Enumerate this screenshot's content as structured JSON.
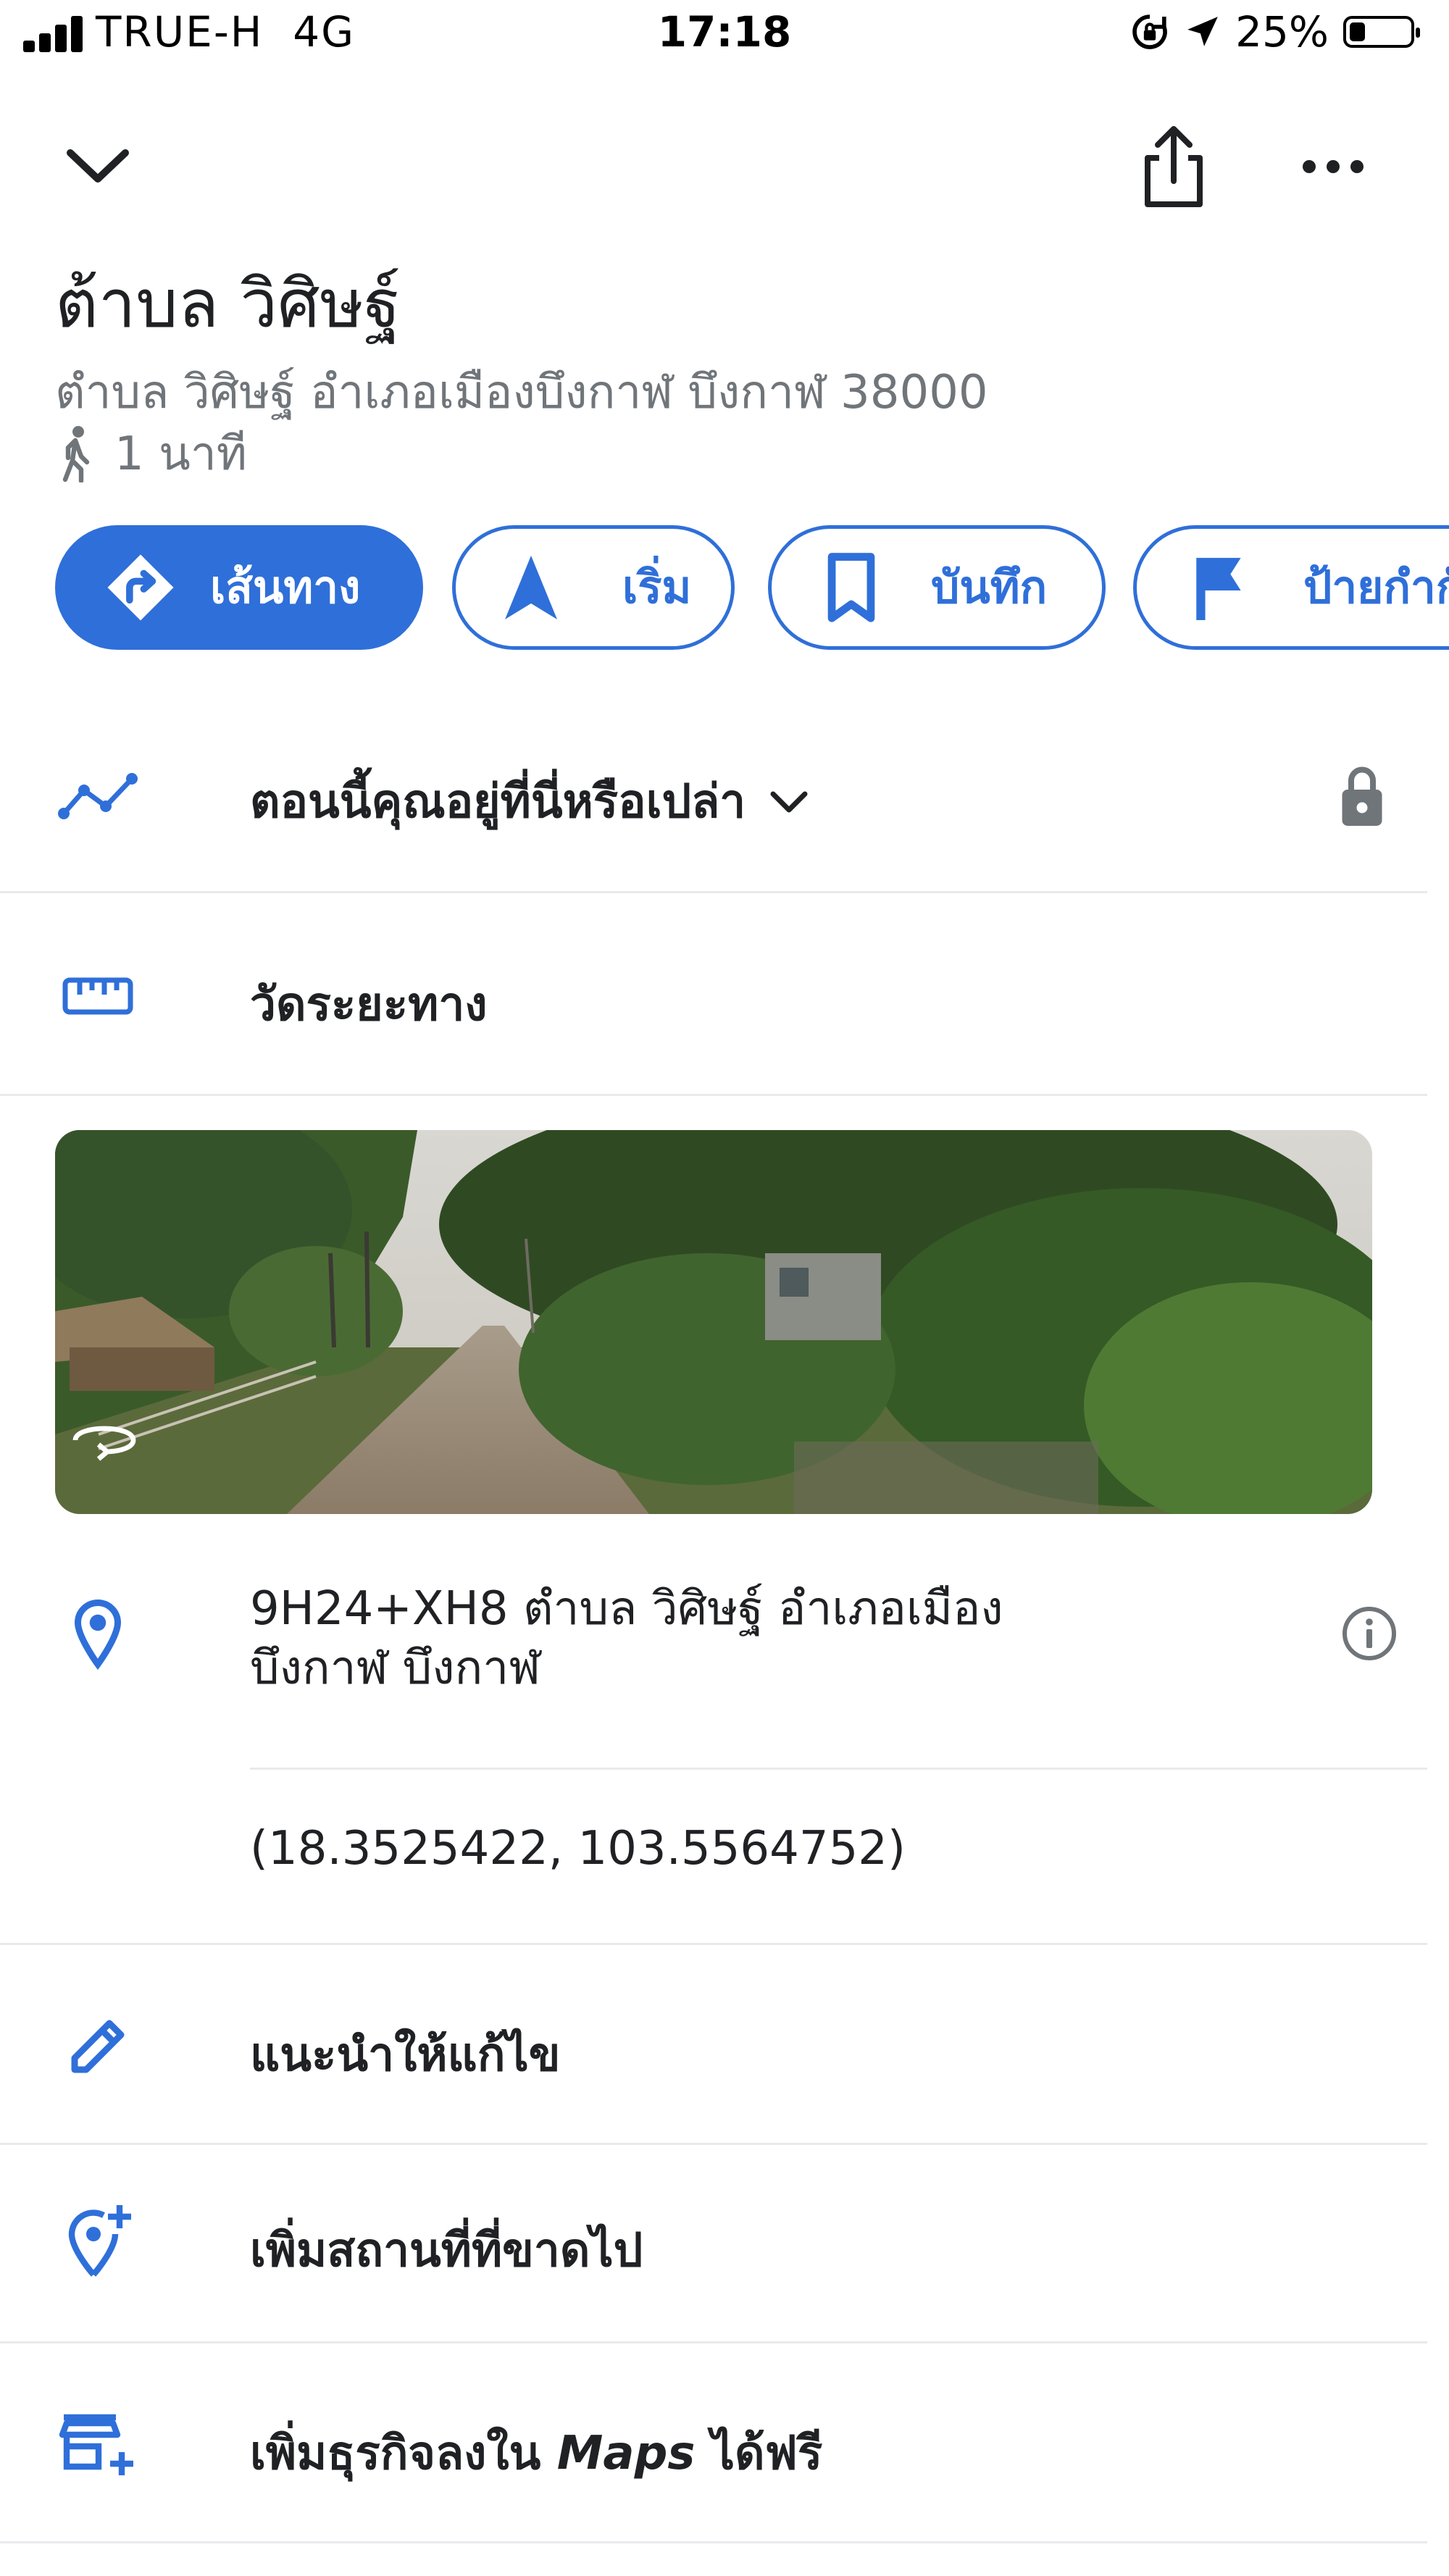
{
  "status_bar": {
    "carrier": "TRUE-H",
    "network": "4G",
    "time": "17:18",
    "battery_percent": "25%",
    "battery_level": 0.25
  },
  "header": {
    "collapse_icon": "chevron-down-icon",
    "share_icon": "share-icon",
    "more_icon": "more-horizontal-icon"
  },
  "place": {
    "title": "ต้าบล วิศิษฐ์",
    "address": "ตำบล วิศิษฐ์ อำเภอเมืองบึงกาฬ บึงกาฬ 38000",
    "walk_time": "1 นาที"
  },
  "actions": [
    {
      "label": "เส้นทาง",
      "icon": "directions-icon"
    },
    {
      "label": "เริ่ม",
      "icon": "navigation-arrow-icon"
    },
    {
      "label": "บันทึก",
      "icon": "bookmark-icon"
    },
    {
      "label": "ป้ายกำกั",
      "icon": "flag-icon"
    }
  ],
  "rows": {
    "timeline": {
      "label": "ตอนนี้คุณอยู่ที่นี่หรือเปล่า",
      "icon": "timeline-icon"
    },
    "measure": {
      "label": "วัดระยะทาง",
      "icon": "ruler-icon"
    },
    "address": {
      "line1": "9H24+XH8 ตำบล วิศิษฐ์ อำเภอเมือง",
      "line2": "บึงกาฬ บึงกาฬ",
      "icon": "location-pin-icon"
    },
    "coords": {
      "label": "(18.3525422, 103.5564752)"
    },
    "suggest_edit": {
      "label": "แนะนำให้แก้ไข",
      "icon": "pencil-icon"
    },
    "add_place": {
      "label": "เพิ่มสถานที่ที่ขาดไป",
      "icon": "add-location-icon"
    },
    "add_business": {
      "label_prefix": "เพิ่มธุรกิจลงใน ",
      "label_italic": "Maps",
      "label_suffix": " ได้ฟรี",
      "icon": "add-business-icon"
    }
  },
  "colors": {
    "accent": "#2f6fd9",
    "text": "#202124",
    "secondary": "#70757a",
    "divider": "#e8eaed"
  }
}
